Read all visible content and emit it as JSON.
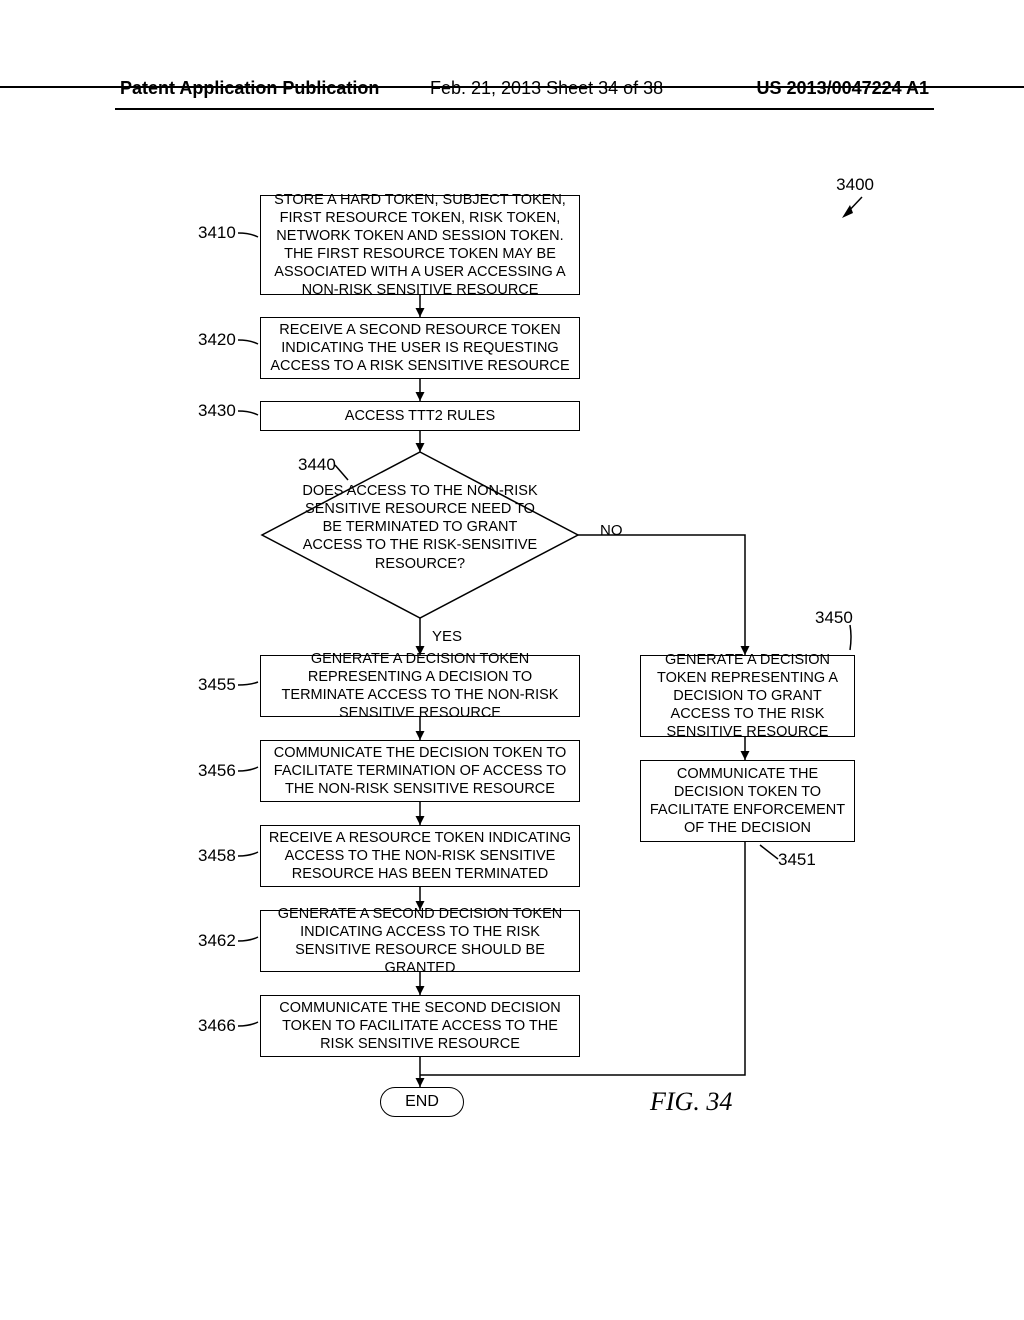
{
  "header": {
    "left": "Patent Application Publication",
    "mid": "Feb. 21, 2013  Sheet 34 of 38",
    "right": "US 2013/0047224 A1"
  },
  "refs": {
    "fig_ref": "3400",
    "b3410": "3410",
    "b3420": "3420",
    "b3430": "3430",
    "b3440": "3440",
    "b3450": "3450",
    "b3451": "3451",
    "b3455": "3455",
    "b3456": "3456",
    "b3458": "3458",
    "b3462": "3462",
    "b3466": "3466"
  },
  "edges": {
    "yes": "YES",
    "no": "NO"
  },
  "boxes": {
    "b3410": "STORE A HARD TOKEN, SUBJECT TOKEN, FIRST RESOURCE TOKEN, RISK TOKEN, NETWORK TOKEN AND SESSION TOKEN. THE FIRST RESOURCE TOKEN MAY BE ASSOCIATED WITH A USER ACCESSING A NON-RISK SENSITIVE RESOURCE",
    "b3420": "RECEIVE A SECOND RESOURCE TOKEN INDICATING THE USER IS REQUESTING ACCESS TO A RISK SENSITIVE RESOURCE",
    "b3430": "ACCESS TTT2 RULES",
    "b3440": "DOES ACCESS TO THE NON-RISK SENSITIVE RESOURCE NEED TO BE TERMINATED TO GRANT ACCESS TO THE RISK-SENSITIVE RESOURCE?",
    "b3450": "GENERATE A DECISION TOKEN REPRESENTING A DECISION TO GRANT ACCESS TO THE RISK SENSITIVE RESOURCE",
    "b3451": "COMMUNICATE THE DECISION TOKEN TO FACILITATE ENFORCEMENT OF THE DECISION",
    "b3455": "GENERATE A DECISION TOKEN REPRESENTING A DECISION TO TERMINATE ACCESS TO THE NON-RISK SENSITIVE RESOURCE",
    "b3456": "COMMUNICATE THE DECISION TOKEN TO FACILITATE TERMINATION OF ACCESS TO THE NON-RISK SENSITIVE RESOURCE",
    "b3458": "RECEIVE A RESOURCE TOKEN INDICATING ACCESS TO THE NON-RISK SENSITIVE RESOURCE HAS BEEN TERMINATED",
    "b3462": "GENERATE A SECOND DECISION TOKEN INDICATING ACCESS TO THE RISK SENSITIVE RESOURCE SHOULD BE GRANTED",
    "b3466": "COMMUNICATE THE SECOND DECISION TOKEN TO FACILITATE ACCESS TO THE RISK SENSITIVE RESOURCE",
    "end": "END"
  },
  "figure_caption": "FIG. 34"
}
